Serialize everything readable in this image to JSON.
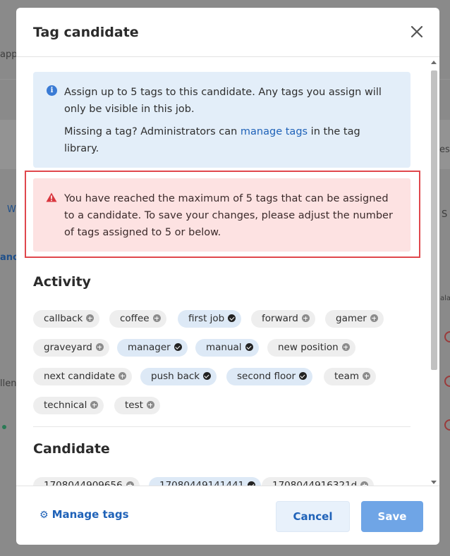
{
  "background": {
    "fragments": [
      "appl",
      "W",
      "anc",
      "llen",
      "ess",
      "S",
      "ala"
    ]
  },
  "modal": {
    "title": "Tag candidate",
    "close_label": "×"
  },
  "info": {
    "line1": "Assign up to 5 tags to this candidate. Any tags you assign will only be visible in this job.",
    "line2_prefix": "Missing a tag? Administrators can ",
    "line2_link": "manage tags",
    "line2_suffix": " in the tag library."
  },
  "error": {
    "message": "You have reached the maximum of 5 tags that can be assigned to a candidate. To save your changes, please adjust the number of tags assigned to 5 or below."
  },
  "sections": [
    {
      "title": "Activity",
      "tags": [
        {
          "label": "callback",
          "selected": false
        },
        {
          "label": "coffee",
          "selected": false
        },
        {
          "label": "first job",
          "selected": true
        },
        {
          "label": "forward",
          "selected": false
        },
        {
          "label": "gamer",
          "selected": false
        },
        {
          "label": "graveyard",
          "selected": false
        },
        {
          "label": "manager",
          "selected": true
        },
        {
          "label": "manual",
          "selected": true
        },
        {
          "label": "new position",
          "selected": false
        },
        {
          "label": "next candidate",
          "selected": false
        },
        {
          "label": "push back",
          "selected": true
        },
        {
          "label": "second floor",
          "selected": true
        },
        {
          "label": "team",
          "selected": false
        },
        {
          "label": "technical",
          "selected": false
        },
        {
          "label": "test",
          "selected": false
        }
      ]
    },
    {
      "title": "Candidate",
      "tags": [
        {
          "label": "1708044909656",
          "selected": false
        },
        {
          "label": "17080449141441",
          "selected": true
        },
        {
          "label": "1708044916321d",
          "selected": false
        }
      ]
    }
  ],
  "footer": {
    "manage_tags_label": "Manage tags",
    "cancel_label": "Cancel",
    "save_label": "Save"
  },
  "colors": {
    "accent": "#1f62b8",
    "info_bg": "#e3eef9",
    "error_bg": "#fde2e2",
    "error_outline": "#e0474c",
    "save_bg": "#6fa5e6"
  }
}
